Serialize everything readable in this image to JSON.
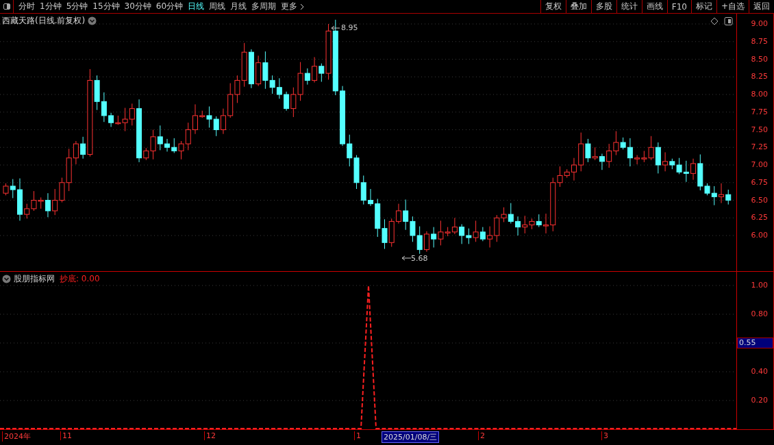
{
  "toolbar": {
    "periods": [
      {
        "label": "分时",
        "selected": false
      },
      {
        "label": "1分钟",
        "selected": false
      },
      {
        "label": "5分钟",
        "selected": false
      },
      {
        "label": "15分钟",
        "selected": false
      },
      {
        "label": "30分钟",
        "selected": false
      },
      {
        "label": "60分钟",
        "selected": false
      },
      {
        "label": "日线",
        "selected": true
      },
      {
        "label": "周线",
        "selected": false
      },
      {
        "label": "月线",
        "selected": false
      },
      {
        "label": "多周期",
        "selected": false
      }
    ],
    "more": "更多",
    "buttons": [
      "复权",
      "叠加",
      "多股",
      "统计",
      "画线",
      "F10",
      "标记",
      "+自选",
      "返回"
    ]
  },
  "main_chart": {
    "title": "西藏天路(日线.前复权)",
    "high_label": "8.95",
    "low_label": "5.68",
    "price_ticks": [
      "9.00",
      "8.75",
      "8.50",
      "8.25",
      "8.00",
      "7.75",
      "7.50",
      "7.25",
      "7.00",
      "6.75",
      "6.50",
      "6.25",
      "6.00"
    ]
  },
  "indicator": {
    "name": "股朋指标网",
    "value_label": "抄底: 0.00",
    "ticks": [
      "1.00",
      "0.80",
      "0.40",
      "0.20"
    ],
    "current_value": "0.55"
  },
  "date_axis": {
    "labels": [
      "2024年",
      "11",
      "12",
      "1",
      "2",
      "3"
    ],
    "cursor_date": "2025/01/08/三"
  }
}
